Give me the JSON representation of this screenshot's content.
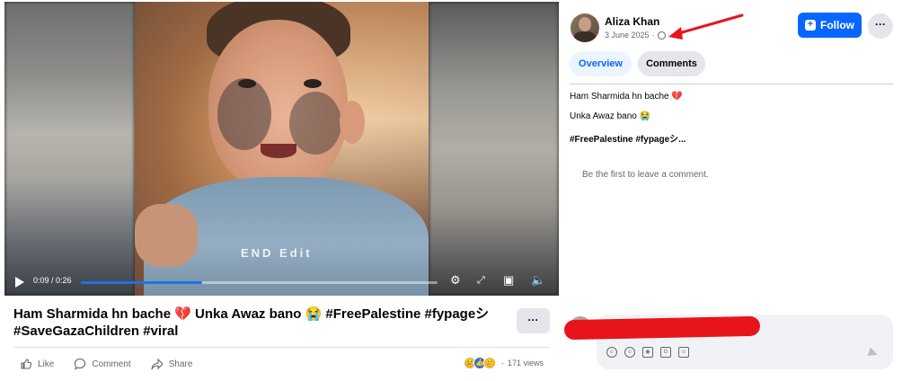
{
  "video": {
    "current_time": "0:09",
    "duration": "0:26",
    "time_label": "0:09 / 0:26",
    "progress": 0.34,
    "watermark": "END Edit"
  },
  "post": {
    "title": "Ham Sharmida hn bache 💔 Unka Awaz bano 😭 #FreePalestine #fypageシ #SaveGazaChildren #viral",
    "more_label": "···",
    "actions": {
      "like": "Like",
      "comment": "Comment",
      "share": "Share"
    },
    "reactions_emoji": [
      "😢",
      "👍",
      "🥲"
    ],
    "views": "171 views"
  },
  "author": {
    "name": "Aliza Khan",
    "date": "3 June 2025",
    "privacy_icon": "globe-icon"
  },
  "header": {
    "follow_label": "Follow",
    "more_label": "···"
  },
  "tabs": [
    {
      "label": "Overview",
      "active": true
    },
    {
      "label": "Comments",
      "active": false
    }
  ],
  "description": {
    "line1": "Ham Sharmida hn bache 💔",
    "line2": "Unka Awaz bano 😭",
    "line3": "#FreePalestine #fypageシ..."
  },
  "comments": {
    "empty_message": "Be the first to leave a comment."
  },
  "composer": {
    "icons": [
      "avatar-sticker-icon",
      "emoji-icon",
      "camera-icon",
      "gif-icon",
      "sticker-icon"
    ],
    "send_icon": "send-icon"
  },
  "colors": {
    "accent": "#0866ff",
    "progress": "#1b74e4",
    "redaction": "#e8141c",
    "annotation_arrow": "#e8141c"
  }
}
